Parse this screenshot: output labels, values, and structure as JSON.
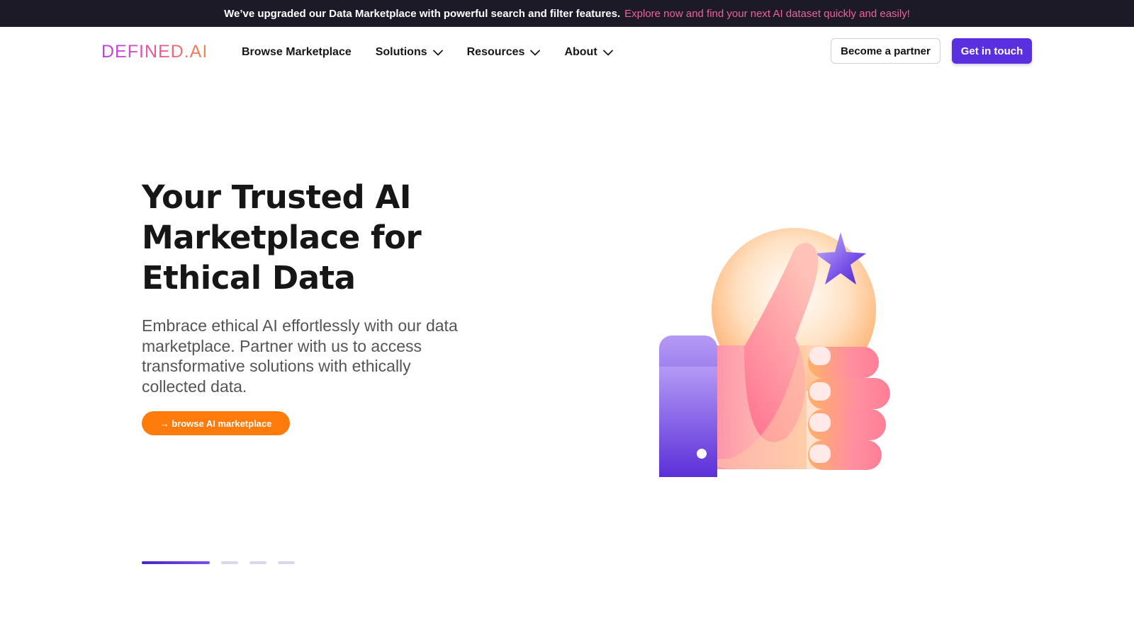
{
  "announcement": {
    "text": "We’ve upgraded our Data Marketplace with powerful search and filter features.",
    "link": "Explore now and find your next AI dataset quickly and easily!"
  },
  "nav": {
    "logo": "DEFINED.AI",
    "items": [
      {
        "label": "Browse Marketplace",
        "has_dropdown": false
      },
      {
        "label": "Solutions",
        "has_dropdown": true
      },
      {
        "label": "Resources",
        "has_dropdown": true
      },
      {
        "label": "About",
        "has_dropdown": true
      }
    ],
    "partner_button": "Become a partner",
    "contact_button": "Get in touch"
  },
  "hero": {
    "title_line1": "Your Trusted AI",
    "title_line2": "Marketplace for",
    "title_line3": "Ethical Data",
    "subtitle": "Embrace ethical AI effortlessly with our data marketplace. Partner with us to access transformative solutions with ethically collected data.",
    "cta": "→ browse AI marketplace",
    "illustration_icon": "thumbs-up-with-star-icon"
  },
  "carousel": {
    "slide_count": 4,
    "active_index": 0
  },
  "colors": {
    "announcement_bg": "#1c1a26",
    "announcement_link": "#f0609c",
    "primary": "#5a2fe0",
    "cta": "#ff7b0c"
  }
}
